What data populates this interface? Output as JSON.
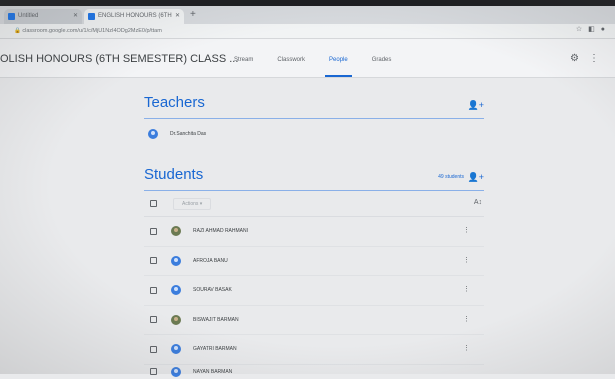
{
  "browser": {
    "tabs": [
      {
        "label": "Untitled"
      },
      {
        "label": "ENGLISH HONOURS (6TH"
      }
    ],
    "url": "classroom.google.com/u/1/c/MjU1NzI4ODg2MzE0/p/ttam",
    "toolbar_icons": [
      "star-icon",
      "extension-icon",
      "profile-icon"
    ]
  },
  "app": {
    "class_title": "OLISH HONOURS (6TH SEMESTER) CLASS ...",
    "tabs": [
      {
        "label": "Stream"
      },
      {
        "label": "Classwork"
      },
      {
        "label": "People"
      },
      {
        "label": "Grades"
      }
    ],
    "active_tab": "People"
  },
  "teachers": {
    "title": "Teachers",
    "list": [
      {
        "name": "Dr.Sanchita Das"
      }
    ]
  },
  "students": {
    "title": "Students",
    "count_label": "49 students",
    "actions_label": "Actions",
    "list": [
      {
        "name": "RAZI AHMAD RAHMANI",
        "avatar": "photo"
      },
      {
        "name": "AFROJA BANU",
        "avatar": "default"
      },
      {
        "name": "SOURAV BASAK",
        "avatar": "default"
      },
      {
        "name": "BISWAJIT BARMAN",
        "avatar": "photo"
      },
      {
        "name": "GAYATRI BARMAN",
        "avatar": "default"
      },
      {
        "name": "NAYAN BARMAN",
        "avatar": "default"
      }
    ]
  },
  "colors": {
    "accent": "#1967d2",
    "background": "#e9eaec"
  }
}
